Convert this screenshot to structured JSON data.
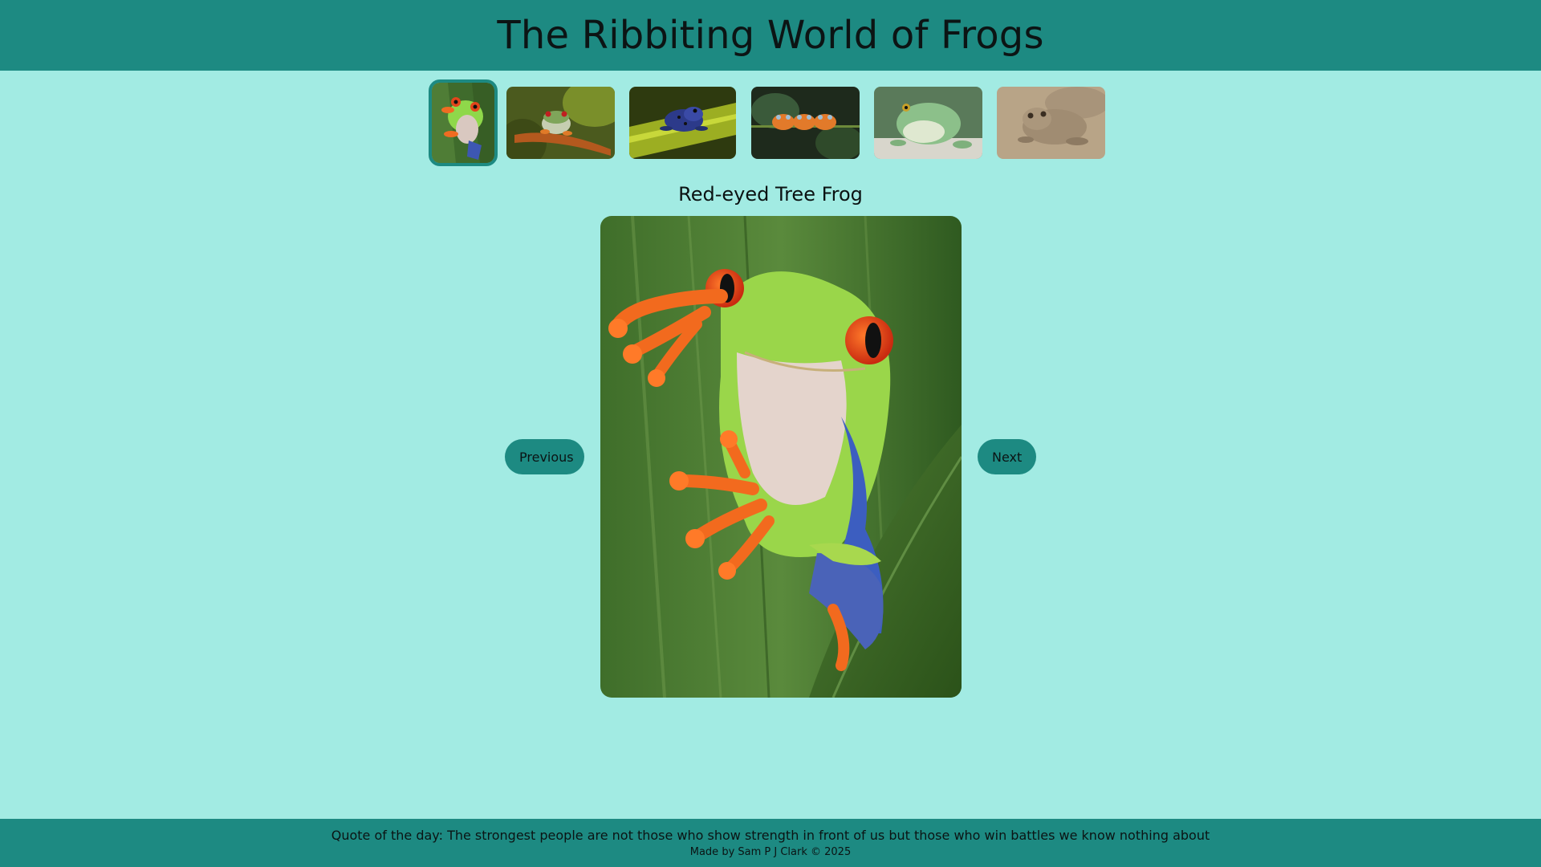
{
  "header": {
    "title": "The Ribbiting World of Frogs"
  },
  "gallery": {
    "thumbnails": [
      {
        "name": "Red-eyed Tree Frog",
        "active": true
      },
      {
        "name": "frog on branch",
        "active": false
      },
      {
        "name": "blue poison dart frog",
        "active": false
      },
      {
        "name": "three frogs on twig",
        "active": false
      },
      {
        "name": "green tree frog",
        "active": false
      },
      {
        "name": "toad",
        "active": false
      }
    ],
    "current_caption": "Red-eyed Tree Frog"
  },
  "nav": {
    "previous_label": "Previous",
    "next_label": "Next"
  },
  "footer": {
    "quote": "Quote of the day: The strongest people are not those who show strength in front of us but those who win battles we know nothing about",
    "credit": "Made by Sam P J Clark © 2025"
  },
  "colors": {
    "background": "#a2ebe3",
    "accent": "#1d8a82"
  }
}
